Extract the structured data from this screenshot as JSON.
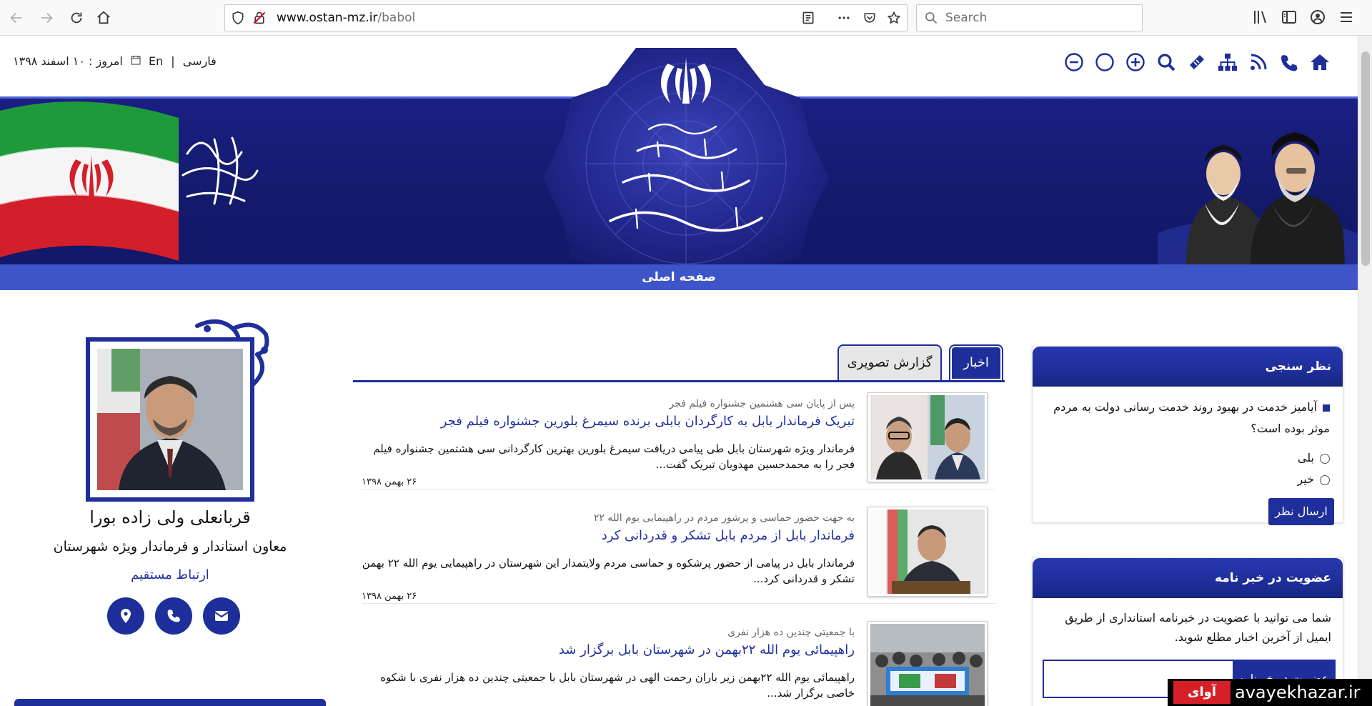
{
  "browser": {
    "url_host": "www.ostan-mz.ir",
    "url_path": "/babol",
    "search_placeholder": "Search"
  },
  "topbar": {
    "date_label": "امروز : ۱۰ اسفند ۱۳۹۸",
    "lang_en": "En",
    "lang_fa": "فارسی",
    "lang_sep": "|"
  },
  "menu": {
    "home": "صفحه اصلی"
  },
  "profile": {
    "name": "قربانعلی ولی زاده بورا",
    "role": "معاون استاندار و فرماندار ویژه شهرستان",
    "contact_link": "ارتباط مستقیم"
  },
  "news": {
    "tabs": [
      {
        "label": "اخبار",
        "active": true
      },
      {
        "label": "گزارش تصویری",
        "active": false
      }
    ],
    "items": [
      {
        "supertitle": "پس از پایان سی هشتمین جشنواره فیلم فجر",
        "title": "تبریک فرماندار بابل به کارگردان بابلی برنده سیمرغ بلورین جشنواره فیلم فجر",
        "summary": "فرماندار ویژه شهرستان بابل طی پیامی دریافت سیمرغ بلورین بهترین کارگردانی سی هشتمین جشنواره فیلم فجر را به محمدحسین مهدویان تبریک گفت...",
        "date": "۲۶ بهمن ۱۳۹۸"
      },
      {
        "supertitle": "به جهت حضور حماسی و پرشور مردم در راهپیمایی یوم الله ۲۲",
        "title": "فرماندار بابل از مردم بابل تشکر و قدردانی کرد",
        "summary": "فرماندار بابل در پیامی از حضور پرشکوه و حماسی مردم ولایتمدار این شهرستان در راهپیمایی یوم الله ۲۲ بهمن تشکر و قدردانی کرد...",
        "date": "۲۶ بهمن ۱۳۹۸"
      },
      {
        "supertitle": "با جمعیتی چندین ده هزار نفری",
        "title": "راهپیمائی یوم الله ۲۲بهمن در شهرستان بابل برگزار شد",
        "summary": "راهپیمائی یوم الله ۲۲بهمن زیر باران رحمت الهی در شهرستان بابل با جمعیتی چندین ده هزار نفری با شکوه خاصی برگزار شد...",
        "date": ""
      }
    ]
  },
  "poll": {
    "title": "نظر سنجی",
    "question": "آیامیز خدمت در بهبود روند خدمت رسانی دولت به مردم موثر بوده است؟",
    "options": [
      "بلی",
      "خیر"
    ],
    "submit": "ارسال نظر"
  },
  "newsletter": {
    "title": "عضویت در خبر نامه",
    "text": "شما می توانید با عضویت در خبرنامه استانداری از طریق ایمیل از آخرین اخبار مطلع شوید.",
    "button": "عضویت در خبرنامه",
    "input_value": ""
  },
  "watermark": {
    "brand_fa": "آوای خزر",
    "brand_en": "avayekhazar.ir"
  },
  "colors": {
    "primary": "#1e2e9a",
    "banner": "#1b1f84",
    "menu": "#3d55c9",
    "link": "#1e2fa0"
  }
}
